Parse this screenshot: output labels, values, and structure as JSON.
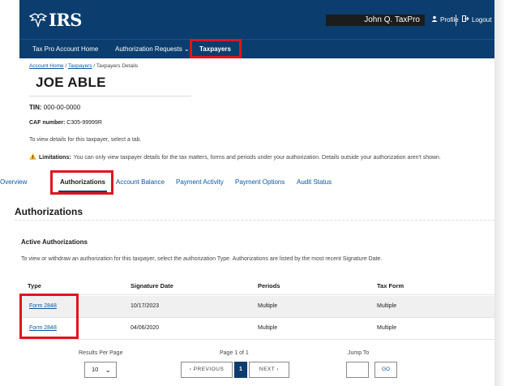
{
  "header": {
    "logo_text": "IRS",
    "user_name": "John Q. TaxPro",
    "profile_label": "Profile",
    "logout_label": "Logout"
  },
  "nav": {
    "items": [
      {
        "label": "Tax Pro Account Home"
      },
      {
        "label": "Authorization Requests"
      },
      {
        "label": "Taxpayers"
      }
    ]
  },
  "breadcrumb": {
    "home": "Account Home",
    "sep1": "/",
    "taxpayers": "Taxpayers",
    "sep2": "/",
    "current": "Taxpayers Details"
  },
  "taxpayer": {
    "name": "JOE ABLE",
    "tin_label": "TIN:",
    "tin_value": "000-00-0000",
    "caf_label": "CAF number:",
    "caf_value": "C305-99999R",
    "hint": "To view details for this taxpayer, select a tab.",
    "limit_label": "Limitations:",
    "limit_text": "You can only view taxpayer details for the tax matters, forms and periods under your authorization. Details outside your authorization aren't shown."
  },
  "tabs": [
    {
      "label": "Overview"
    },
    {
      "label": "Authorizations"
    },
    {
      "label": "Account Balance"
    },
    {
      "label": "Payment Activity"
    },
    {
      "label": "Payment Options"
    },
    {
      "label": "Audit Status"
    }
  ],
  "section": {
    "title": "Authorizations",
    "subtitle": "Active Authorizations",
    "instruction": "To view or withdraw an authorization for this taxpayer, select the authorization Type. Authorizations are listed by the most recent Signature Date."
  },
  "table": {
    "headers": [
      "Type",
      "Signature Date",
      "Periods",
      "Tax Form"
    ],
    "rows": [
      {
        "type": "Form 2848",
        "date": "10/17/2023",
        "periods": "Multiple",
        "form": "Multiple"
      },
      {
        "type": "Form 2848",
        "date": "04/06/2020",
        "periods": "Multiple",
        "form": "Multiple"
      }
    ]
  },
  "pagination": {
    "per_page_label": "Results Per Page",
    "per_page_value": "10",
    "page_label": "Page 1 of 1",
    "prev_label": "PREVIOUS",
    "current_page": "1",
    "next_label": "NEXT",
    "jump_label": "Jump To",
    "go_label": "GO"
  },
  "colors": {
    "brand_navy": "#0b3d6e",
    "link_blue": "#0b57a4",
    "highlight_red": "#e0141e",
    "warning_yellow": "#f2b21b"
  },
  "icons": [
    "irs-eagle-icon",
    "user-icon",
    "logout-icon",
    "chevron-down-icon",
    "warning-icon",
    "chevron-left-icon",
    "chevron-right-icon"
  ]
}
